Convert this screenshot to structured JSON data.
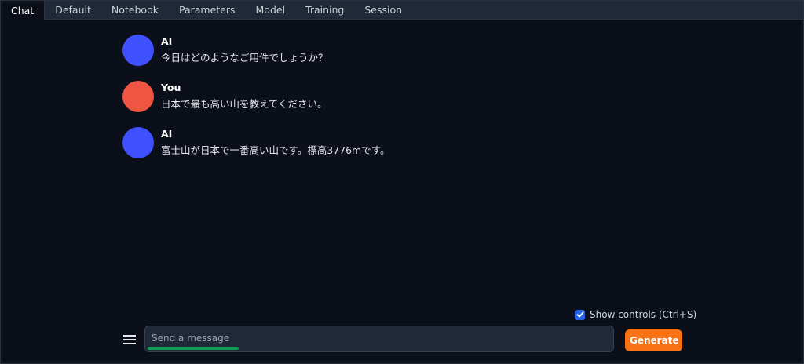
{
  "tabs": [
    {
      "label": "Chat",
      "active": true
    },
    {
      "label": "Default",
      "active": false
    },
    {
      "label": "Notebook",
      "active": false
    },
    {
      "label": "Parameters",
      "active": false
    },
    {
      "label": "Model",
      "active": false
    },
    {
      "label": "Training",
      "active": false
    },
    {
      "label": "Session",
      "active": false
    }
  ],
  "messages": [
    {
      "author": "AI",
      "text": "今日はどのようなご用件でしょうか？",
      "avatar_color": "#3f51ff"
    },
    {
      "author": "You",
      "text": "日本で最も高い山を教えてください。",
      "avatar_color": "#f05443"
    },
    {
      "author": "AI",
      "text": "富士山が日本で一番高い山です。標高3776mです。",
      "avatar_color": "#3f51ff"
    }
  ],
  "controls": {
    "show_controls_label": "Show controls (Ctrl+S)",
    "show_controls_checked": true
  },
  "input": {
    "placeholder": "Send a message",
    "value": ""
  },
  "generate": {
    "label": "Generate"
  },
  "colors": {
    "background": "#0b0f19",
    "tabbar": "#1f2937",
    "accent_blue": "#2563eb",
    "generate_orange": "#f97316",
    "progress_green": "#0f9d58"
  }
}
